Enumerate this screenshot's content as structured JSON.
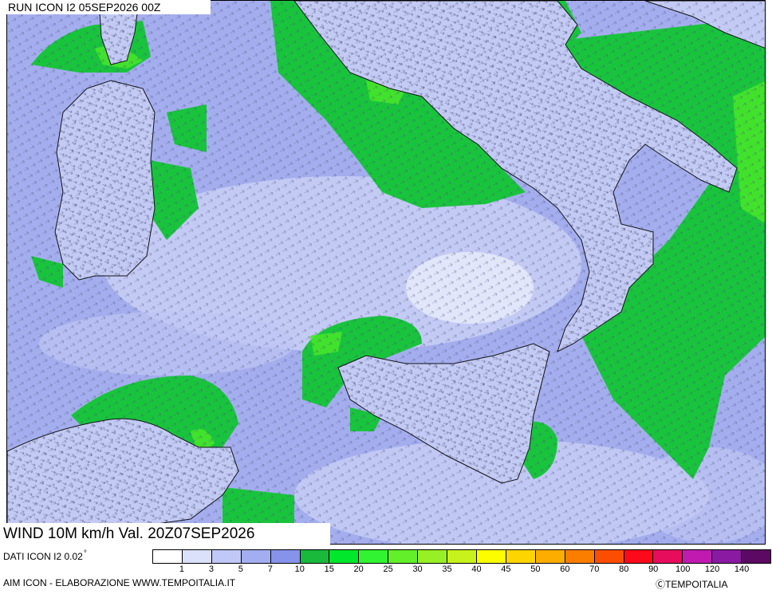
{
  "header": {
    "run_label": "RUN ICON I2 05SEP2026 00Z"
  },
  "map": {
    "region": "Southern Italy, Sardinia, Sicily, Tunisia coast",
    "field": "10 m wind speed with arrows"
  },
  "footer": {
    "field_label": "WIND 10M km/h Val. 20Z07SEP2026",
    "data_source": "DATI ICON I2 0.02",
    "data_source_unit": "°",
    "credits": "AIM ICON - ELABORAZIONE WWW.TEMPOITALIA.IT",
    "copyright": "ⒸTEMPOITALIA"
  },
  "legend": {
    "unit": "km/h",
    "thresholds": [
      1,
      3,
      5,
      7,
      10,
      15,
      20,
      25,
      30,
      35,
      40,
      45,
      50,
      60,
      70,
      80,
      90,
      100,
      120,
      140
    ],
    "tick_labels": [
      "1",
      "3",
      "5",
      "7",
      "10",
      "15",
      "20",
      "25",
      "30",
      "35",
      "40",
      "45",
      "50",
      "60",
      "70",
      "80",
      "90",
      "100",
      "120",
      "140"
    ],
    "colors": [
      "#ffffff",
      "#dce1fb",
      "#bfc8f6",
      "#a2aef0",
      "#8792ea",
      "#19b93b",
      "#00e72b",
      "#31f331",
      "#63f02a",
      "#97ef26",
      "#c8f21c",
      "#fdfd00",
      "#fdd500",
      "#fcad00",
      "#fc7e00",
      "#fc4e00",
      "#fc0a1a",
      "#e60e5c",
      "#c11ab1",
      "#8b1aa3",
      "#5c0963"
    ]
  },
  "colors": {
    "sea_light": "#c7cdf4",
    "sea_mid": "#a4aeee",
    "sea_strong": "#8790ea",
    "land": "#b9c2f2",
    "green": "#19c43d",
    "green_bright": "#46e62a",
    "coastline": "#111111"
  }
}
